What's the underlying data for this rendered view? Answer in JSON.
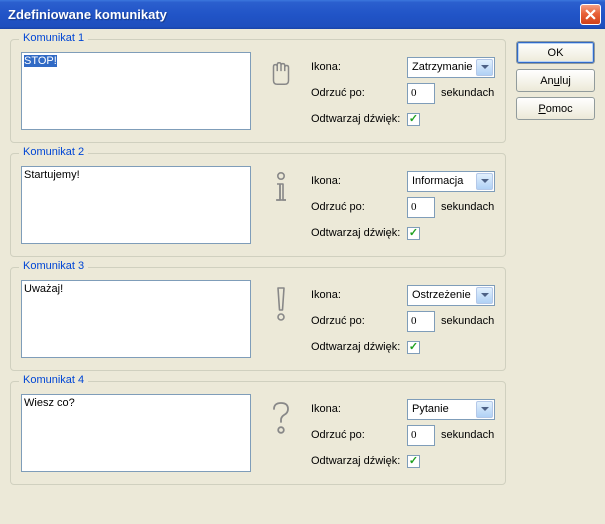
{
  "title": "Zdefiniowane komunikaty",
  "buttons": {
    "ok": "OK",
    "cancel_pre": "An",
    "cancel_u": "u",
    "cancel_post": "luj",
    "help_u": "P",
    "help_post": "omoc"
  },
  "labels": {
    "icon": "Ikona:",
    "dismiss": "Odrzuć po:",
    "seconds": "sekundach",
    "play_sound": "Odtwarzaj dźwięk:"
  },
  "messages": [
    {
      "legend": "Komunikat 1",
      "text": "STOP!",
      "icon_type": "Zatrzymanie",
      "dismiss": "0",
      "sound": true,
      "highlighted": true,
      "icon_name": "hand"
    },
    {
      "legend": "Komunikat 2",
      "text": "Startujemy!",
      "icon_type": "Informacja",
      "dismiss": "0",
      "sound": true,
      "highlighted": false,
      "icon_name": "info"
    },
    {
      "legend": "Komunikat 3",
      "text": "Uważaj!",
      "icon_type": "Ostrzeżenie",
      "dismiss": "0",
      "sound": true,
      "highlighted": false,
      "icon_name": "exclaim"
    },
    {
      "legend": "Komunikat 4",
      "text": "Wiesz co?",
      "icon_type": "Pytanie",
      "dismiss": "0",
      "sound": true,
      "highlighted": false,
      "icon_name": "question"
    }
  ]
}
